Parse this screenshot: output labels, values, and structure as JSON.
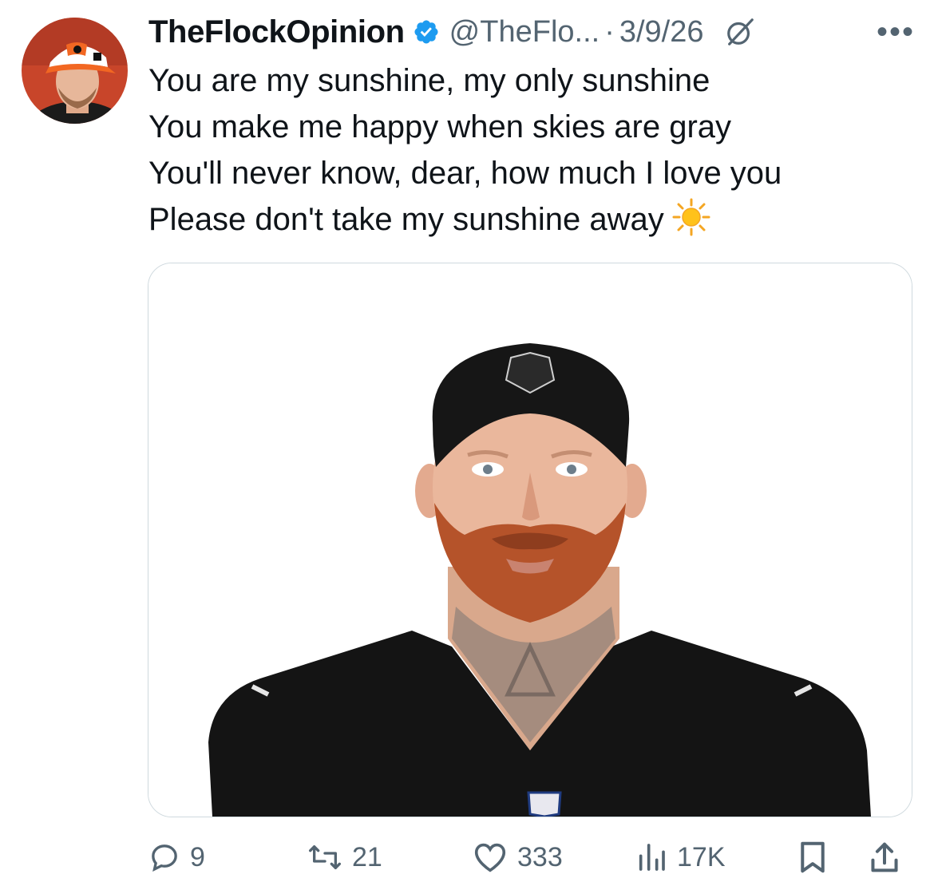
{
  "tweet": {
    "display_name": "TheFlockOpinion",
    "handle": "@TheFlo...",
    "separator": "·",
    "date": "3/9/26",
    "more": "•••",
    "text_lines": [
      "You are my sunshine, my only sunshine",
      "You make me happy when skies are gray",
      "You'll never know, dear, how much I love you",
      "Please don't take my sunshine away"
    ],
    "emoji": "sun-emoji"
  },
  "media": {
    "subject": "player-headshot",
    "jersey_color": "#111111",
    "beard_color": "#b5532a"
  },
  "actions": {
    "replies": "9",
    "reposts": "21",
    "likes": "333",
    "views": "17K"
  },
  "colors": {
    "text": "#0f1419",
    "secondary": "#536471",
    "verified": "#1d9bf0",
    "border": "#cfd9de"
  },
  "icons": [
    "verified-badge-icon",
    "grok-icon",
    "more-icon",
    "reply-icon",
    "repost-icon",
    "like-icon",
    "views-icon",
    "bookmark-icon",
    "share-icon"
  ]
}
